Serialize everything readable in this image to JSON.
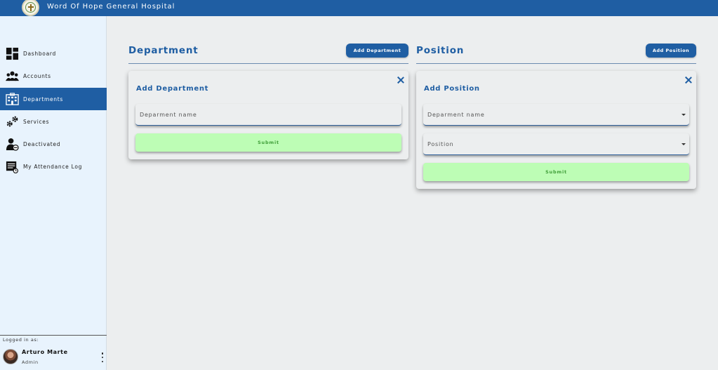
{
  "app": {
    "title": "Word Of Hope General Hospital",
    "logo_icon": "hospital-seal-icon"
  },
  "sidebar": {
    "items": [
      {
        "label": "Dashboard",
        "icon": "dashboard-icon",
        "active": false
      },
      {
        "label": "Accounts",
        "icon": "users-icon",
        "active": false
      },
      {
        "label": "Departments",
        "icon": "building-icon",
        "active": true
      },
      {
        "label": "Services",
        "icon": "gears-icon",
        "active": false
      },
      {
        "label": "Deactivated",
        "icon": "user-minus-icon",
        "active": false
      },
      {
        "label": "My Attendance Log",
        "icon": "log-icon",
        "active": false
      }
    ],
    "logged_as_label": "Logged in as:",
    "user": {
      "name": "Arturo Marte",
      "role": "Admin"
    }
  },
  "department": {
    "title": "Department",
    "add_button": "Add Department",
    "form": {
      "title": "Add Department",
      "name_placeholder": "Deparment name",
      "submit": "Submit"
    }
  },
  "position": {
    "title": "Position",
    "add_button": "Add Position",
    "form": {
      "title": "Add Position",
      "department_placeholder": "Deparment name",
      "position_placeholder": "Position",
      "submit": "Submit"
    }
  },
  "colors": {
    "primary": "#1f5ea3",
    "sidebar_bg": "#e8f3fd",
    "page_bg": "#eceeef",
    "submit_bg": "#bdfdb5",
    "submit_text": "#3f9e38"
  }
}
